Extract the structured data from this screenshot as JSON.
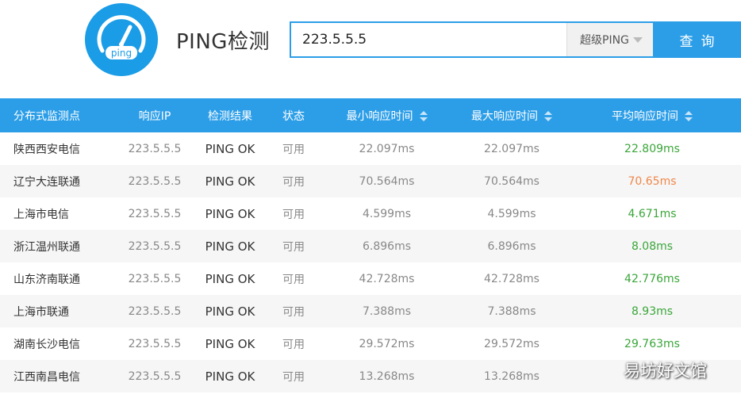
{
  "header": {
    "logo_text": "ping",
    "title": "PING检测",
    "search_value": "223.5.5.5",
    "mode": "超级PING",
    "query_label": "查询"
  },
  "table": {
    "columns": [
      "分布式监测点",
      "响应IP",
      "检测结果",
      "状态",
      "最小响应时间",
      "最大响应时间",
      "平均响应时间"
    ],
    "rows": [
      {
        "location": "陕西西安电信",
        "ip": "223.5.5.5",
        "result": "PING OK",
        "status": "可用",
        "min": "22.097ms",
        "max": "22.097ms",
        "avg": "22.809ms",
        "avg_level": "good"
      },
      {
        "location": "辽宁大连联通",
        "ip": "223.5.5.5",
        "result": "PING OK",
        "status": "可用",
        "min": "70.564ms",
        "max": "70.564ms",
        "avg": "70.65ms",
        "avg_level": "warn"
      },
      {
        "location": "上海市电信",
        "ip": "223.5.5.5",
        "result": "PING OK",
        "status": "可用",
        "min": "4.599ms",
        "max": "4.599ms",
        "avg": "4.671ms",
        "avg_level": "good"
      },
      {
        "location": "浙江温州联通",
        "ip": "223.5.5.5",
        "result": "PING OK",
        "status": "可用",
        "min": "6.896ms",
        "max": "6.896ms",
        "avg": "8.08ms",
        "avg_level": "good"
      },
      {
        "location": "山东济南联通",
        "ip": "223.5.5.5",
        "result": "PING OK",
        "status": "可用",
        "min": "42.728ms",
        "max": "42.728ms",
        "avg": "42.776ms",
        "avg_level": "good"
      },
      {
        "location": "上海市联通",
        "ip": "223.5.5.5",
        "result": "PING OK",
        "status": "可用",
        "min": "7.388ms",
        "max": "7.388ms",
        "avg": "8.93ms",
        "avg_level": "good"
      },
      {
        "location": "湖南长沙电信",
        "ip": "223.5.5.5",
        "result": "PING OK",
        "status": "可用",
        "min": "29.572ms",
        "max": "29.572ms",
        "avg": "29.763ms",
        "avg_level": "good"
      },
      {
        "location": "江西南昌电信",
        "ip": "223.5.5.5",
        "result": "PING OK",
        "status": "可用",
        "min": "13.268ms",
        "max": "13.268ms",
        "avg": "",
        "avg_level": "good"
      }
    ]
  },
  "colors": {
    "accent": "#2c9ee8",
    "good": "#3aa63a",
    "warn": "#f0874a"
  },
  "watermark": "易坊好文馆"
}
